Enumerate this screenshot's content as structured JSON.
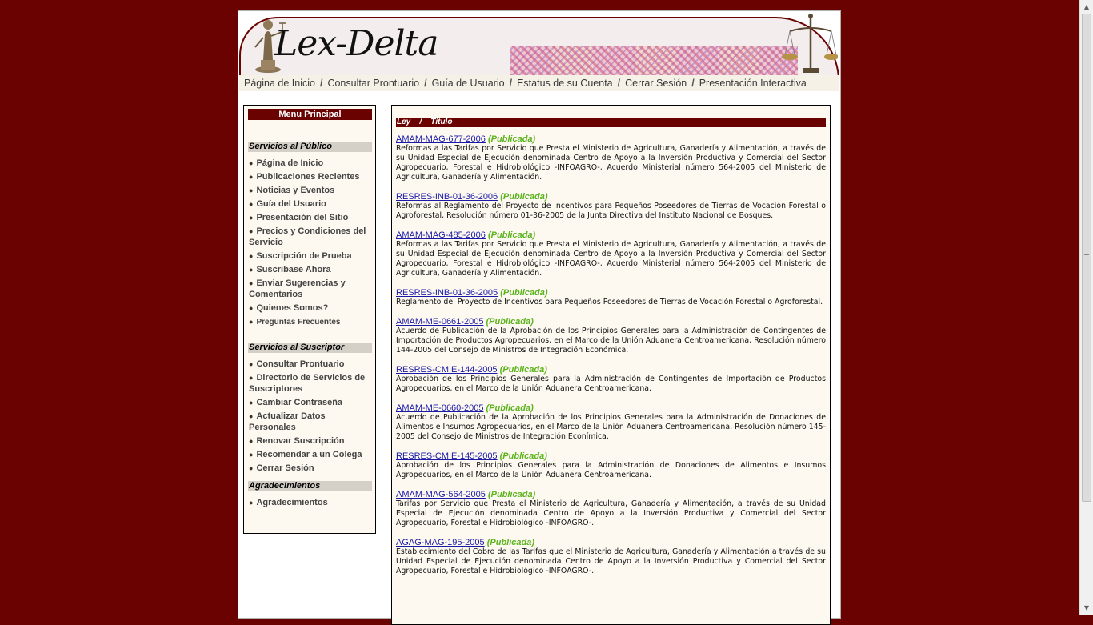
{
  "header": {
    "logo_text": "Lex-Delta"
  },
  "nav": [
    "Página de Inicio",
    "Consultar Prontuario",
    "Guía de Usuario",
    "Estatus de su Cuenta",
    "Cerrar Sesión",
    "Presentación Interactiva"
  ],
  "nav_separator": "/",
  "sidebar": {
    "title": "Menu Principal",
    "sections": [
      {
        "title": "Servicios al Público",
        "items": [
          "Página de Inicio",
          "Publicaciones Recientes",
          "Noticias y Eventos",
          "Guía del Usuario",
          "Presentación del Sitio",
          "Precios y Condiciones del Servicio",
          "Suscripción de Prueba",
          "Suscribase Ahora",
          "Enviar Sugerencias y Comentarios",
          "Quienes Somos?",
          "Preguntas Frecuentes"
        ]
      },
      {
        "title": "Servicios al Suscriptor",
        "items": [
          "Consultar Prontuario",
          "Directorio de Servicios de Suscriptores",
          "Cambiar Contraseña",
          "Actualizar Datos Personales",
          "Renovar Suscripción",
          "Recomendar a un Colega",
          "Cerrar Sesión"
        ]
      },
      {
        "title": "Agradecimientos",
        "items": [
          "Agradecimientos"
        ]
      }
    ]
  },
  "content": {
    "header": "Ley    /    Título",
    "laws": [
      {
        "code": "AMAM-MAG-677-2006",
        "status": "(Publicada)",
        "description": "Reformas a las Tarifas por Servicio que Presta el Ministerio de Agricultura, Ganadería y Alimentación, a través de su Unidad Especial de Ejecución denominada Centro de Apoyo a la Inversión Productiva y Comercial del Sector Agropecuario, Forestal e Hidrobiológico -INFOAGRO-, Acuerdo Ministerial número 564-2005 del Ministerio de Agricultura, Ganadería y Alimentación."
      },
      {
        "code": "RESRES-INB-01-36-2006",
        "status": "(Publicada)",
        "description": "Reformas al Reglamento del Proyecto de Incentivos para Pequeños Poseedores de Tierras de Vocación Forestal o Agroforestal, Resolución número 01-36-2005 de la Junta Directiva del Instituto Nacional de Bosques."
      },
      {
        "code": "AMAM-MAG-485-2006",
        "status": "(Publicada)",
        "description": "Reformas a las Tarifas por Servicio que Presta el Ministerio de Agricultura, Ganadería y Alimentación, a través de su Unidad Especial de Ejecución denominada Centro de Apoyo a la Inversión Productiva y Comercial del Sector Agropecuario, Forestal e Hidrobiológico -INFOAGRO-, Acuerdo Ministerial número 564-2005 del Ministerio de Agricultura, Ganadería y Alimentación."
      },
      {
        "code": "RESRES-INB-01-36-2005",
        "status": "(Publicada)",
        "description": "Reglamento del Proyecto de Incentivos para Pequeños Poseedores de Tierras de Vocación Forestal o Agroforestal."
      },
      {
        "code": "AMAM-ME-0661-2005",
        "status": "(Publicada)",
        "description": "Acuerdo de Publicación de la Aprobación de los Principios Generales para la Administración de Contingentes de Importación de Productos Agropecuarios, en el Marco de la Unión Aduanera Centroamericana, Resolución número 144-2005 del Consejo de Ministros de Integración Económica."
      },
      {
        "code": "RESRES-CMIE-144-2005",
        "status": "(Publicada)",
        "description": "Aprobación de los Principios Generales para la Administración de Contingentes de Importación de Productos Agropecuarios, en el Marco de la Unión Aduanera Centroamericana."
      },
      {
        "code": "AMAM-ME-0660-2005",
        "status": "(Publicada)",
        "description": "Acuerdo de Publicación de la Aprobación de los Principios Generales para la Administración de Donaciones de Alimentos e Insumos Agropecuarios, en el Marco de la Unión Aduanera Centroamericana, Resolución número 145-2005 del Consejo de Ministros de Integración Econímica."
      },
      {
        "code": "RESRES-CMIE-145-2005",
        "status": "(Publicada)",
        "description": "Aprobación de los Principios Generales para la Administración de Donaciones de Alimentos e Insumos Agropecuarios, en el Marco de la Unión Aduanera Centroamericana."
      },
      {
        "code": "AMAM-MAG-564-2005",
        "status": "(Publicada)",
        "description": "Tarifas por Servicio que Presta el Ministerio de Agricultura, Ganadería y Alimentación, a través de su Unidad Especial de Ejecución denominada Centro de Apoyo a la Inversión Productiva y Comercial del Sector Agropecuario, Forestal e Hidrobiológico -INFOAGRO-."
      },
      {
        "code": "AGAG-MAG-195-2005",
        "status": "(Publicada)",
        "description": "Establecimiento del Cobro de las Tarifas que el Ministerio de Agricultura, Ganadería y Alimentación a través de su Unidad Especial de Ejecución denominada Centro de Apoyo a la Inversión Productiva y Comercial del Sector Agropecuario, Forestal e Hidrobiológico -INFOAGRO-."
      }
    ]
  },
  "colors": {
    "background": "#6b0202",
    "header_bar": "#6b0202",
    "section_bar": "#d4d0c8",
    "link": "#1a1aa6",
    "status": "#5cb41e",
    "panel": "#fdf9f0"
  }
}
